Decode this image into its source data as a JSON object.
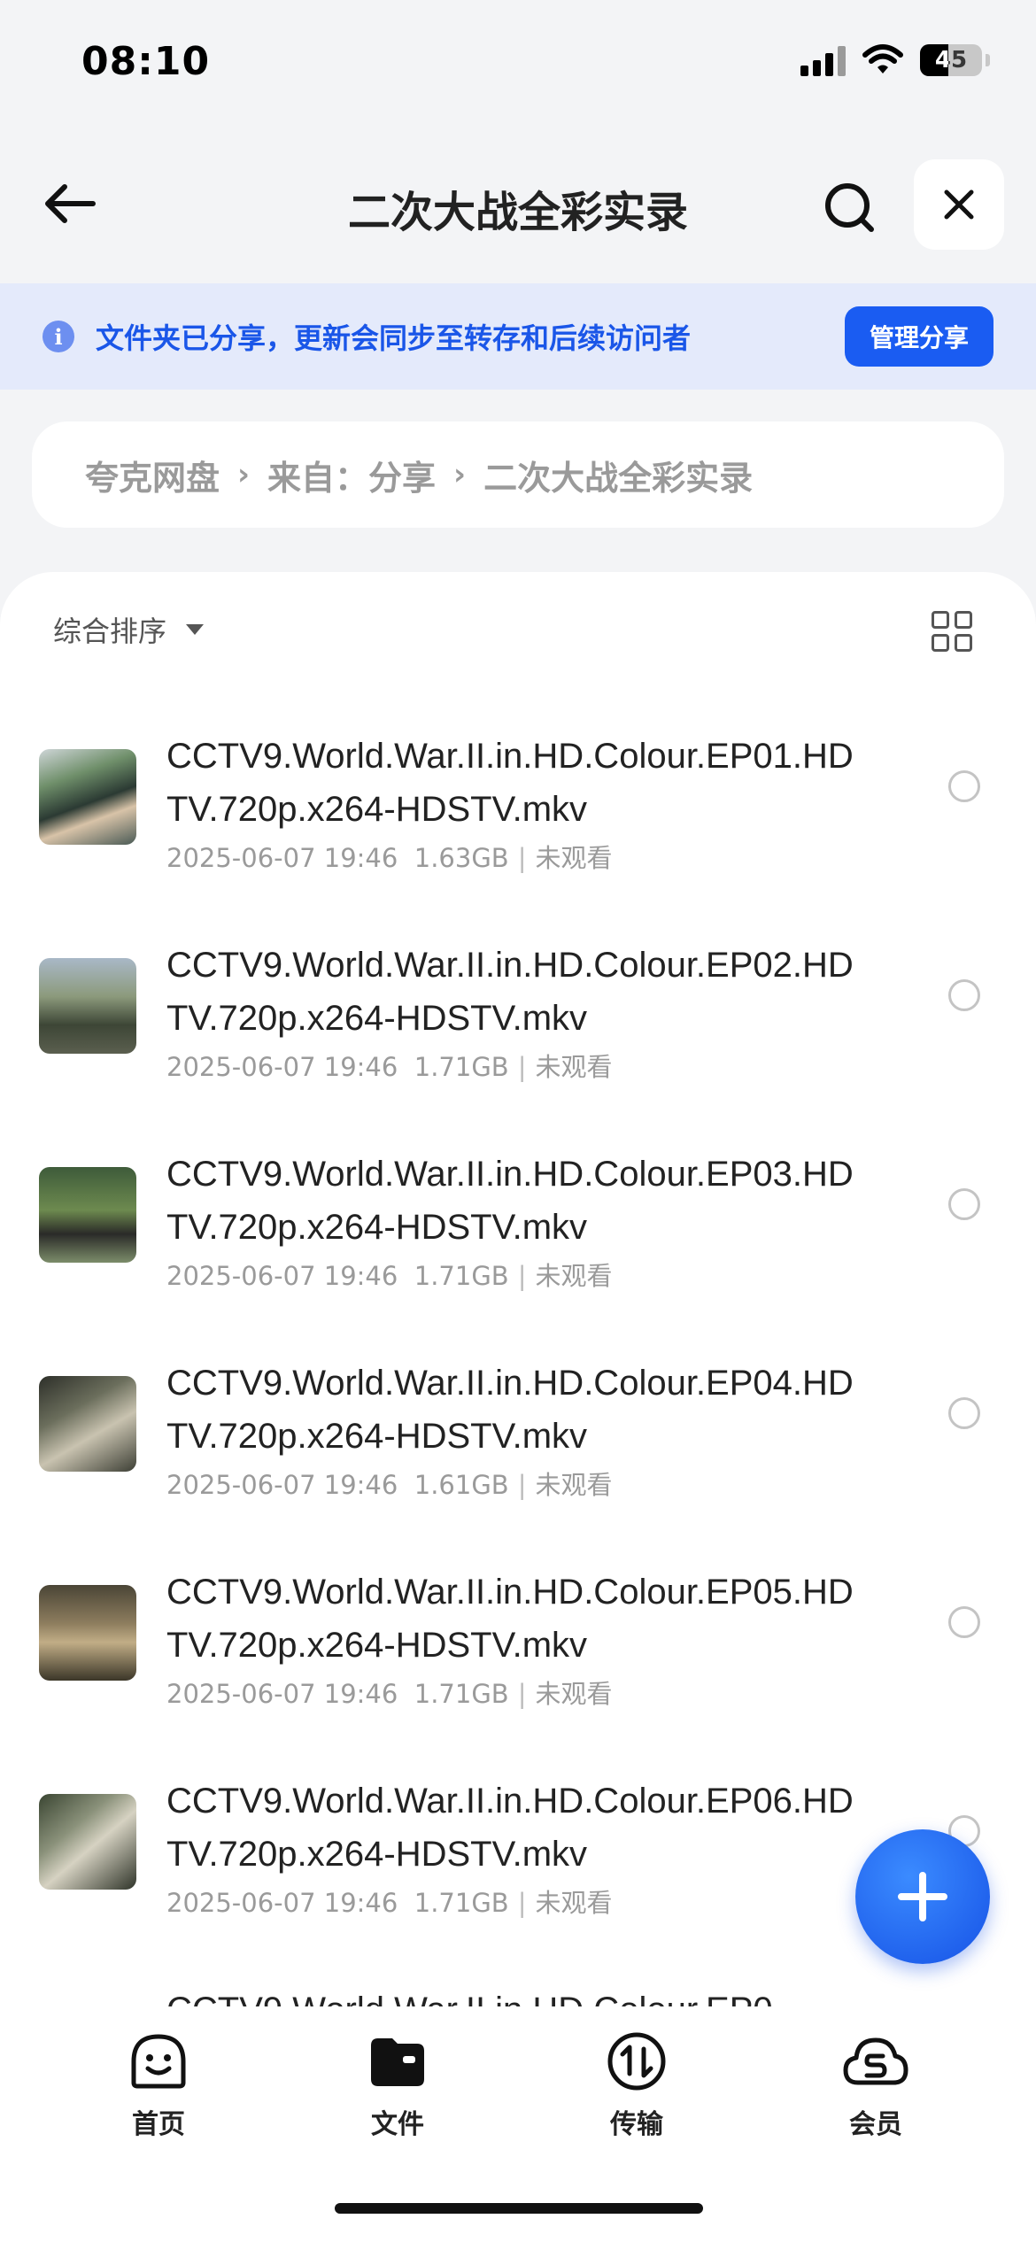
{
  "status_bar": {
    "time": "08:10",
    "battery": "45"
  },
  "nav": {
    "title": "二次大战全彩实录"
  },
  "share_banner": {
    "text": "文件夹已分享，更新会同步至转存和后续访问者",
    "button": "管理分享"
  },
  "breadcrumb": {
    "items": [
      "夸克网盘",
      "来自：分享",
      "二次大战全彩实录"
    ]
  },
  "sort": {
    "label": "综合排序"
  },
  "files": [
    {
      "name": "CCTV9.World.War.II.in.HD.Colour.EP01.HDTV.720p.x264-HDSTV.mkv",
      "date": "2025-06-07 19:46",
      "size": "1.63GB",
      "status": "未观看"
    },
    {
      "name": "CCTV9.World.War.II.in.HD.Colour.EP02.HDTV.720p.x264-HDSTV.mkv",
      "date": "2025-06-07 19:46",
      "size": "1.71GB",
      "status": "未观看"
    },
    {
      "name": "CCTV9.World.War.II.in.HD.Colour.EP03.HDTV.720p.x264-HDSTV.mkv",
      "date": "2025-06-07 19:46",
      "size": "1.71GB",
      "status": "未观看"
    },
    {
      "name": "CCTV9.World.War.II.in.HD.Colour.EP04.HDTV.720p.x264-HDSTV.mkv",
      "date": "2025-06-07 19:46",
      "size": "1.61GB",
      "status": "未观看"
    },
    {
      "name": "CCTV9.World.War.II.in.HD.Colour.EP05.HDTV.720p.x264-HDSTV.mkv",
      "date": "2025-06-07 19:46",
      "size": "1.71GB",
      "status": "未观看"
    },
    {
      "name": "CCTV9.World.War.II.in.HD.Colour.EP06.HDTV.720p.x264-HDSTV.mkv",
      "date": "2025-06-07 19:46",
      "size": "1.71GB",
      "status": "未观看"
    },
    {
      "name": "CCTV9.World.War.II.in.HD.Colour.EP0"
    }
  ],
  "tabs": [
    {
      "label": "首页",
      "icon": "smile-face-icon"
    },
    {
      "label": "文件",
      "icon": "folder-icon"
    },
    {
      "label": "传输",
      "icon": "transfer-icon"
    },
    {
      "label": "会员",
      "icon": "cloud-member-icon"
    }
  ],
  "colors": {
    "accent": "#1A5CF2",
    "banner_bg": "#E4EAFB",
    "page_bg": "#F3F4F6"
  }
}
